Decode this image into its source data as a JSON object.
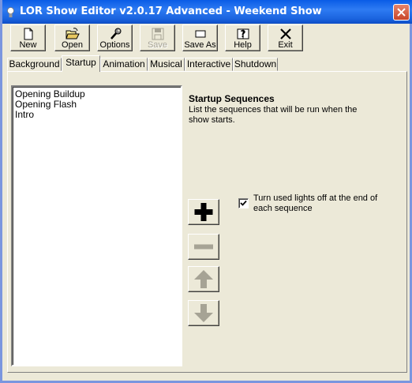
{
  "window": {
    "title": "LOR Show Editor v2.0.17 Advanced - Weekend Show"
  },
  "toolbar": {
    "buttons": [
      {
        "label": "New",
        "icon": "new-document-icon",
        "enabled": true
      },
      {
        "label": "Open",
        "icon": "open-folder-icon",
        "enabled": true
      },
      {
        "label": "Options",
        "icon": "wrench-icon",
        "enabled": true
      },
      {
        "label": "Save",
        "icon": "floppy-disk-icon",
        "enabled": false
      },
      {
        "label": "Save As",
        "icon": "save-as-icon",
        "enabled": true
      },
      {
        "label": "Help",
        "icon": "help-icon",
        "enabled": true
      },
      {
        "label": "Exit",
        "icon": "exit-x-icon",
        "enabled": true
      }
    ]
  },
  "tabs": {
    "items": [
      "Background",
      "Startup",
      "Animation",
      "Musical",
      "Interactive",
      "Shutdown"
    ],
    "active": "Startup"
  },
  "startup": {
    "sequences": [
      "Opening Buildup",
      "Opening Flash",
      "Intro"
    ],
    "heading": "Startup Sequences",
    "description": "List the sequences that will be run when the show starts.",
    "lights_off_checkbox": {
      "label": "Turn used lights off at the end of each sequence",
      "checked": true
    },
    "buttons": [
      {
        "icon": "add-plus-icon",
        "enabled": true
      },
      {
        "icon": "remove-minus-icon",
        "enabled": false
      },
      {
        "icon": "move-up-arrow-icon",
        "enabled": false
      },
      {
        "icon": "move-down-arrow-icon",
        "enabled": false
      }
    ]
  },
  "colors": {
    "title_bar": "#0A5CE6",
    "face": "#ECE9D8",
    "disabled": "#A6A395"
  }
}
